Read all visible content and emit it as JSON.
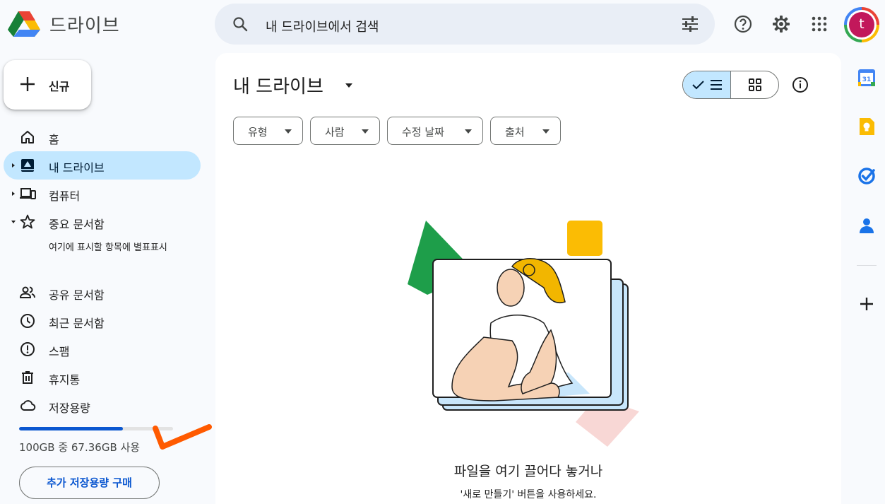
{
  "app": {
    "title": "드라이브"
  },
  "search": {
    "placeholder": "내 드라이브에서 검색"
  },
  "account": {
    "initial": "t"
  },
  "sidebar": {
    "new_label": "신규",
    "items": [
      {
        "label": "홈",
        "icon": "home-icon"
      },
      {
        "label": "내 드라이브",
        "icon": "my-drive-icon",
        "active": true
      },
      {
        "label": "컴퓨터",
        "icon": "computers-icon"
      },
      {
        "label": "중요 문서함",
        "icon": "star-icon"
      },
      {
        "label": "공유 문서함",
        "icon": "shared-icon"
      },
      {
        "label": "최근 문서함",
        "icon": "clock-icon"
      },
      {
        "label": "스팸",
        "icon": "spam-icon"
      },
      {
        "label": "휴지통",
        "icon": "trash-icon"
      },
      {
        "label": "저장용량",
        "icon": "cloud-icon"
      }
    ],
    "starred_hint": "여기에 표시할 항목에 별표표시",
    "storage": {
      "text": "100GB 중 67.36GB 사용",
      "used_fraction": 0.6736,
      "buy_label": "추가 저장용량 구매"
    }
  },
  "main": {
    "title": "내 드라이브",
    "filters": [
      "유형",
      "사람",
      "수정 날짜",
      "출처"
    ],
    "empty_title": "파일을 여기 끌어다 놓거나",
    "empty_subtitle": "'새로 만들기' 버튼을 사용하세요."
  },
  "colors": {
    "accent": "#0b57d0",
    "active_bg": "#c2e7ff",
    "surface": "#f8fafd",
    "annotation": "#ff5a00"
  }
}
